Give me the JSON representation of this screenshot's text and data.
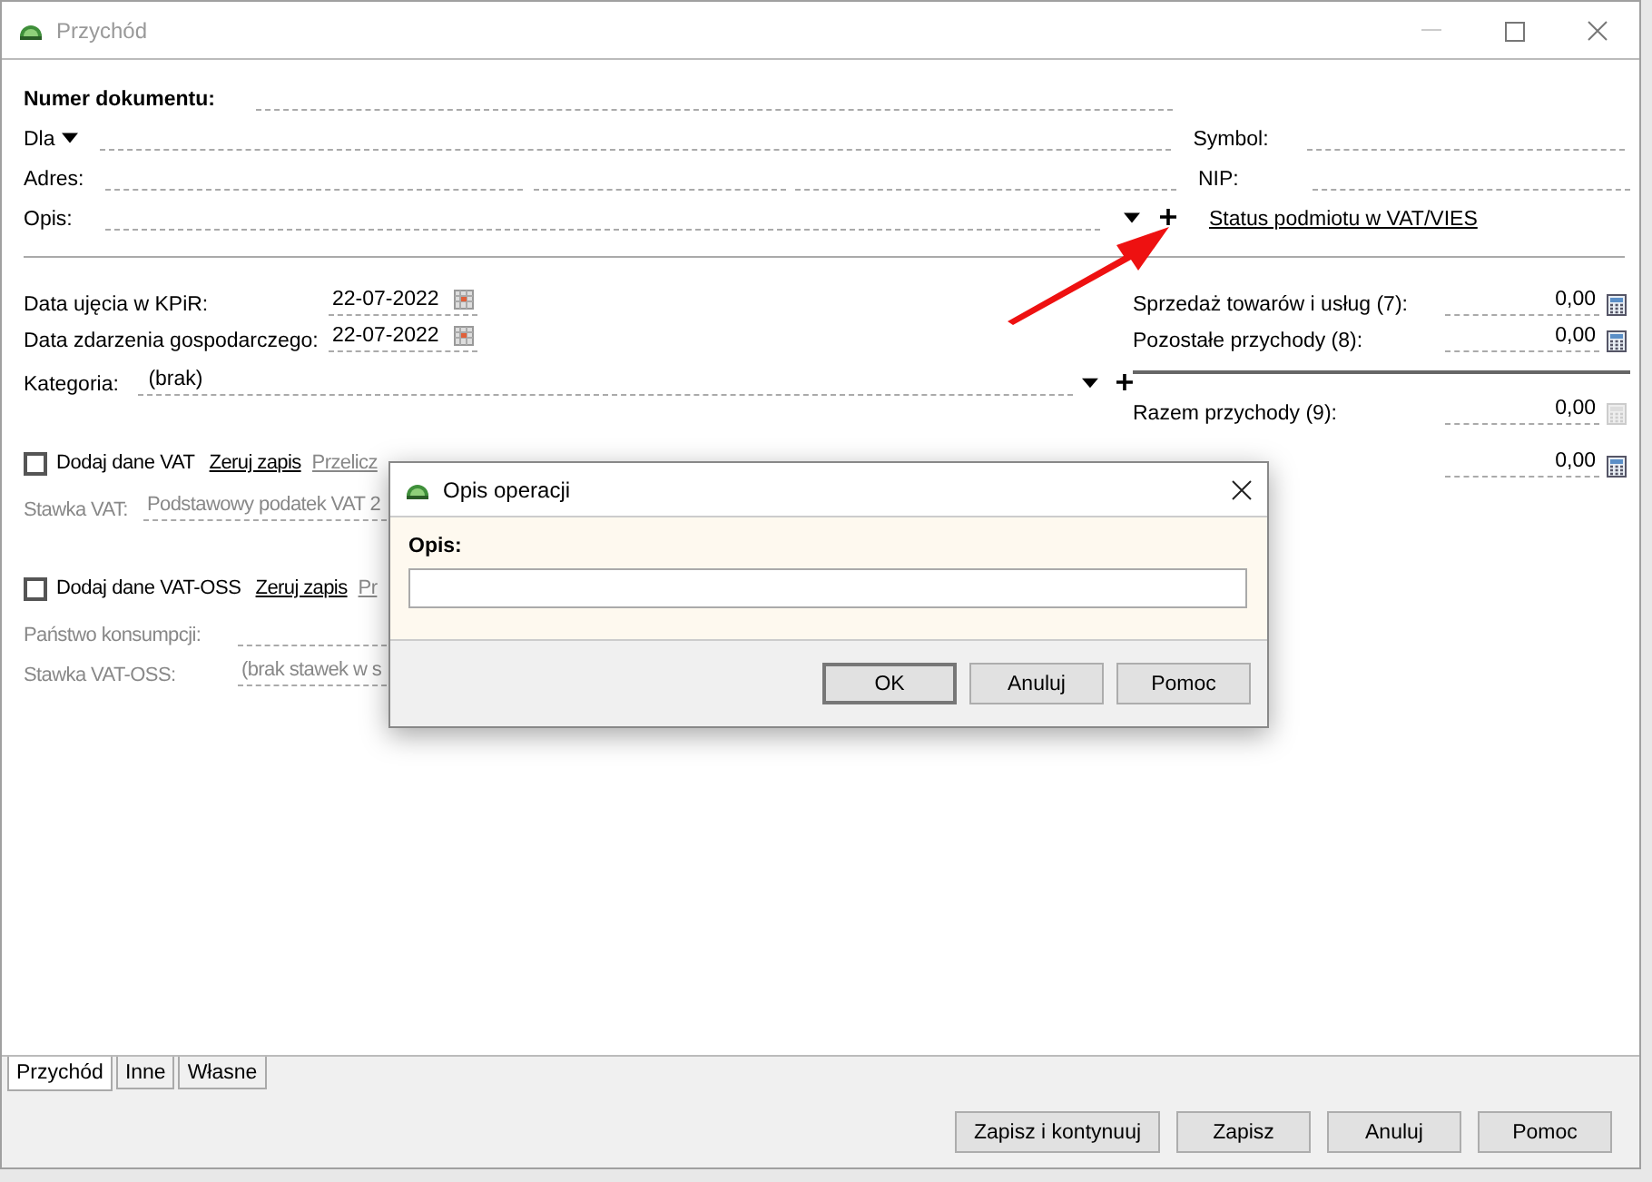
{
  "window": {
    "title": "Przychód"
  },
  "header": {
    "document_number_label": "Numer dokumentu:",
    "for_label": "Dla",
    "symbol_label": "Symbol:",
    "address_label": "Adres:",
    "nip_label": "NIP:",
    "description_label": "Opis:",
    "vies_link": "Status podmiotu w VAT/VIES"
  },
  "dates": [
    {
      "label": "Data ujęcia w KPiR:",
      "value": "22-07-2022"
    },
    {
      "label": "Data zdarzenia gospodarczego:",
      "value": "22-07-2022"
    }
  ],
  "category": {
    "label": "Kategoria:",
    "value": "(brak)"
  },
  "vat_sections": [
    {
      "checkbox": {
        "label": "Dodaj dane VAT",
        "checked": false
      },
      "reset_link": "Zeruj zapis",
      "recalc_link": "Przelicz",
      "fields": [
        {
          "label": "Stawka VAT:",
          "value": "Podstawowy podatek VAT 2"
        }
      ]
    },
    {
      "checkbox": {
        "label": "Dodaj dane VAT-OSS",
        "checked": false
      },
      "reset_link": "Zeruj zapis",
      "recalc_link": "Pr",
      "fields": [
        {
          "label": "Państwo konsumpcji:"
        },
        {
          "label": "Stawka VAT-OSS:",
          "value": "(brak stawek w s"
        }
      ]
    }
  ],
  "totals": [
    {
      "kind": "entry",
      "label": "Sprzedaż towarów i usług (7):",
      "value": "0,00",
      "disabled": false
    },
    {
      "kind": "entry",
      "label": "Pozostałe przychody (8):",
      "value": "0,00",
      "disabled": false
    },
    {
      "kind": "sum",
      "label": "Razem przychody (9):",
      "value": "0,00",
      "disabled": true
    },
    {
      "kind": "entry",
      "value": "0,00",
      "disabled": false
    }
  ],
  "dialog": {
    "title": "Opis operacji",
    "field_label": "Opis:",
    "buttons": [
      {
        "label": "OK",
        "default": true
      },
      {
        "label": "Anuluj",
        "default": false
      },
      {
        "label": "Pomoc",
        "default": false
      }
    ]
  },
  "tabs": [
    {
      "label": "Przychód",
      "selected": true
    },
    {
      "label": "Inne",
      "selected": false
    },
    {
      "label": "Własne",
      "selected": false
    }
  ],
  "buttons": [
    "Zapisz i kontynuuj",
    "Zapisz",
    "Anuluj",
    "Pomoc"
  ]
}
